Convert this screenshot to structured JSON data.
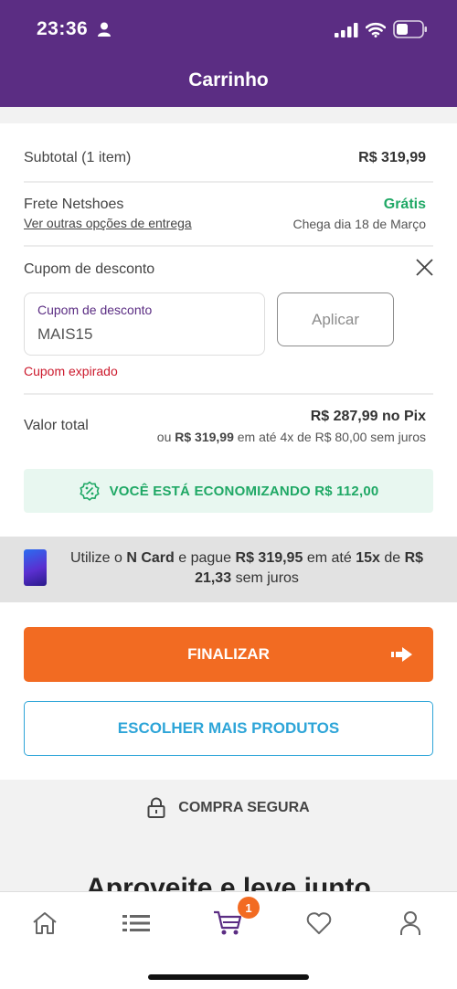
{
  "status_bar": {
    "time": "23:36"
  },
  "header": {
    "title": "Carrinho"
  },
  "summary": {
    "subtotal_label": "Subtotal (1 item)",
    "subtotal_value": "R$ 319,99",
    "shipping_label": "Frete Netshoes",
    "shipping_link": "Ver outras opções de entrega",
    "shipping_value": "Grátis",
    "shipping_arrival": "Chega dia 18 de Março"
  },
  "coupon": {
    "section_label": "Cupom de desconto",
    "input_label": "Cupom de desconto",
    "input_value": "MAIS15",
    "apply_label": "Aplicar",
    "error": "Cupom expirado"
  },
  "total": {
    "label": "Valor total",
    "pix": "R$ 287,99 no Pix",
    "installment_prefix": "ou",
    "installment_amount": "R$ 319,99",
    "installment_suffix": "em até 4x de R$ 80,00 sem juros"
  },
  "savings": {
    "text": "VOCÊ ESTÁ ECONOMIZANDO R$ 112,00"
  },
  "ncard": {
    "p1": "Utilize o",
    "card_name": "N Card",
    "p2": "e pague",
    "amount": "R$ 319,95",
    "p3": "em até",
    "installments": "15x",
    "p4": "de",
    "installment_value": "R$ 21,33",
    "p5": "sem juros"
  },
  "actions": {
    "finalize_label": "FINALIZAR",
    "more_products_label": "ESCOLHER MAIS PRODUTOS"
  },
  "secure": {
    "label": "COMPRA SEGURA"
  },
  "recommend": {
    "heading": "Aproveite e leve junto"
  },
  "tabbar": {
    "cart_badge": "1"
  },
  "colors": {
    "brand_purple": "#5b2d83",
    "accent_orange": "#f26b22",
    "success_green": "#1fa865",
    "error_red": "#cc1a2d",
    "link_blue": "#2ea5d8"
  }
}
